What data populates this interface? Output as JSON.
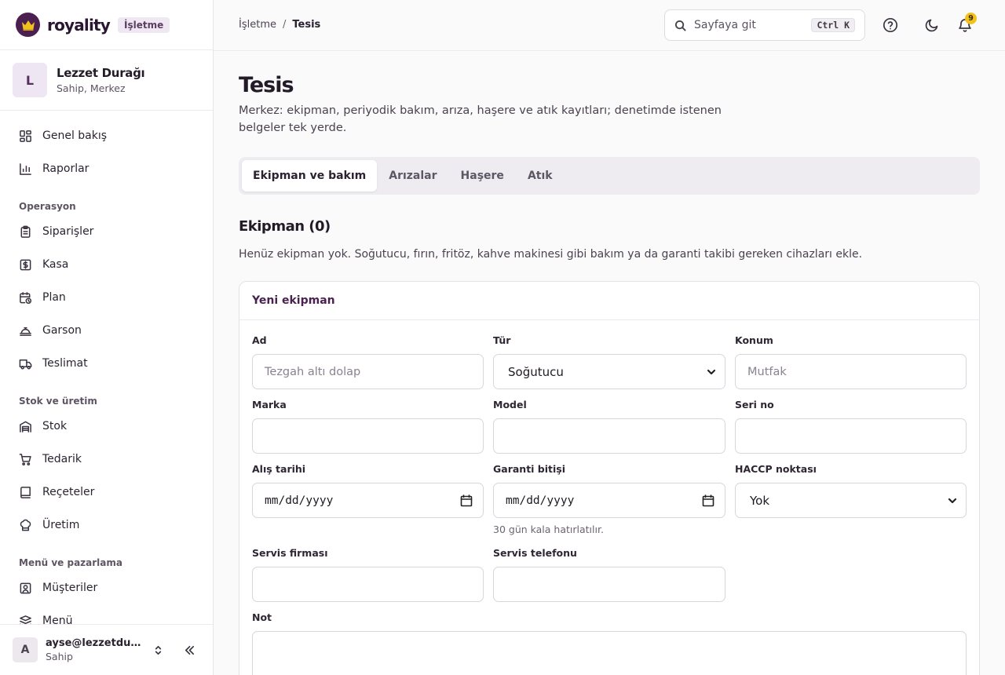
{
  "brand": {
    "name": "royality",
    "badge": "İşletme"
  },
  "org": {
    "avatar": "L",
    "name": "Lezzet Durağı",
    "role": "Sahip, Merkez"
  },
  "nav": {
    "top": [
      {
        "label": "Genel bakış",
        "icon": "dashboard-icon"
      },
      {
        "label": "Raporlar",
        "icon": "bar-chart-icon"
      }
    ],
    "sections": [
      {
        "title": "Operasyon",
        "items": [
          {
            "label": "Siparişler",
            "icon": "clipboard-icon"
          },
          {
            "label": "Kasa",
            "icon": "cash-icon"
          },
          {
            "label": "Plan",
            "icon": "calendar-clock-icon"
          },
          {
            "label": "Garson",
            "icon": "concierge-bell-icon"
          },
          {
            "label": "Teslimat",
            "icon": "truck-icon"
          }
        ]
      },
      {
        "title": "Stok ve üretim",
        "items": [
          {
            "label": "Stok",
            "icon": "warehouse-icon"
          },
          {
            "label": "Tedarik",
            "icon": "cart-icon"
          },
          {
            "label": "Reçeteler",
            "icon": "book-icon"
          },
          {
            "label": "Üretim",
            "icon": "chef-hat-icon"
          }
        ]
      },
      {
        "title": "Menü ve pazarlama",
        "items": [
          {
            "label": "Müşteriler",
            "icon": "user-square-icon"
          },
          {
            "label": "Menü",
            "icon": "menu-book-icon"
          }
        ]
      }
    ]
  },
  "user": {
    "avatar": "A",
    "email": "ayse@lezzetduragi.com",
    "role": "Sahip"
  },
  "topbar": {
    "breadcrumb": {
      "parent": "İşletme",
      "separator": "/",
      "current": "Tesis"
    },
    "search": {
      "placeholder": "Sayfaya git",
      "shortcut": "Ctrl K"
    },
    "notifications": "9"
  },
  "page": {
    "title": "Tesis",
    "description": "Merkez: ekipman, periyodik bakım, arıza, haşere ve atık kayıtları; denetimde istenen belgeler tek yerde.",
    "tabs": [
      "Ekipman ve bakım",
      "Arızalar",
      "Haşere",
      "Atık"
    ],
    "section_title": "Ekipman (0)",
    "section_desc": "Henüz ekipman yok. Soğutucu, fırın, fritöz, kahve makinesi gibi bakım ya da garanti takibi gereken cihazları ekle."
  },
  "form": {
    "title": "Yeni ekipman",
    "name": {
      "label": "Ad",
      "placeholder": "Tezgah altı dolap"
    },
    "type": {
      "label": "Tür",
      "value": "Soğutucu"
    },
    "location": {
      "label": "Konum",
      "placeholder": "Mutfak"
    },
    "brand": {
      "label": "Marka"
    },
    "model": {
      "label": "Model"
    },
    "serial": {
      "label": "Seri no"
    },
    "purchase_date": {
      "label": "Alış tarihi",
      "value": "mm/dd/yyyy"
    },
    "warranty_end": {
      "label": "Garanti bitişi",
      "value": "mm/dd/yyyy",
      "hint": "30 gün kala hatırlatılır."
    },
    "haccp": {
      "label": "HACCP noktası",
      "value": "Yok"
    },
    "service_company": {
      "label": "Servis firması"
    },
    "service_phone": {
      "label": "Servis telefonu"
    },
    "note": {
      "label": "Not"
    }
  }
}
